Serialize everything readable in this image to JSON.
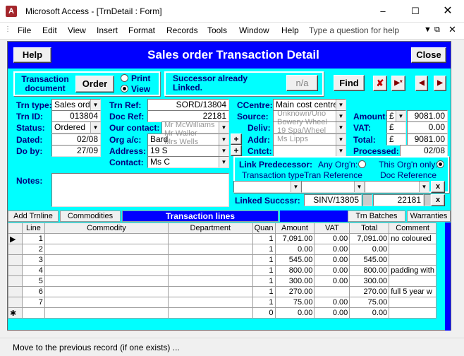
{
  "window": {
    "title": "Microsoft Access - [TrnDetail : Form]",
    "app_icon": "A"
  },
  "menu": [
    "File",
    "Edit",
    "View",
    "Insert",
    "Format",
    "Records",
    "Tools",
    "Window",
    "Help"
  ],
  "help_box": {
    "placeholder": "Type a question for help"
  },
  "header": {
    "help": "Help",
    "title": "Sales order Transaction Detail",
    "close": "Close"
  },
  "trans_doc": {
    "label_line1": "Transaction",
    "label_line2": "document",
    "order_btn": "Order",
    "print": "Print",
    "view": "View",
    "selected": "View"
  },
  "successor": {
    "line1": "Successor already",
    "line2": "Linked.",
    "btn": "n/a"
  },
  "toolbar": {
    "find": "Find"
  },
  "left": {
    "trn_type_label": "Trn type:",
    "trn_type": "Sales orde",
    "trn_id_label": "Trn ID:",
    "trn_id": "013804",
    "status_label": "Status:",
    "status": "Ordered",
    "dated_label": "Dated:",
    "dated": "02/08",
    "doby_label": "Do by:",
    "doby": "27/09"
  },
  "mid": {
    "trn_ref_label": "Trn Ref:",
    "trn_ref": "SORD/13804",
    "doc_ref_label": "Doc Ref:",
    "doc_ref": "22181",
    "our_contact_label": "Our contact:",
    "org_ac_label": "Org a/c:",
    "org_ac": "Bard",
    "address_label": "Address:",
    "address": "19 S",
    "contact_label": "Contact:",
    "contact": "Ms C"
  },
  "right": {
    "ccentre_label": "CCentre:",
    "ccentre": "Main cost centre",
    "source_label": "Source:",
    "deliv_label": "Deliv:",
    "addr_label": "Addr:",
    "cntct_label": "Cntct:",
    "amount_label": "Amount:",
    "amount_cur": "£",
    "amount": "9081.00",
    "vat_label": "VAT:",
    "vat_cur": "£",
    "vat": "0.00",
    "total_label": "Total:",
    "total_cur": "£",
    "total": "9081.00",
    "processed_label": "Processed:",
    "processed": "02/08"
  },
  "link": {
    "title": "Link Predecessor:",
    "any_org": "Any Org'n:",
    "this_org": "This Org'n only:",
    "col1": "Transaction type",
    "col2": "Tran Reference",
    "col3": "Doc Reference",
    "linked_label": "Linked Succssr:",
    "linked_ref": "SINV/13805",
    "linked_doc": "22181",
    "x": "x"
  },
  "notes_label": "Notes:",
  "tabs": [
    "Add Trnline",
    "Commodities",
    "Transaction lines",
    "Trn Batches",
    "Warranties"
  ],
  "grid": {
    "columns": [
      "Line",
      "Commodity",
      "Department",
      "Quan",
      "Amount",
      "VAT",
      "Total",
      "Comment"
    ],
    "rows": [
      [
        "1",
        "",
        "",
        "1",
        "7,091.00",
        "0.00",
        "7,091.00",
        "no coloured"
      ],
      [
        "2",
        "",
        "",
        "1",
        "0.00",
        "0.00",
        "0.00",
        ""
      ],
      [
        "3",
        "",
        "",
        "1",
        "545.00",
        "0.00",
        "545.00",
        ""
      ],
      [
        "4",
        "",
        "",
        "1",
        "800.00",
        "0.00",
        "800.00",
        "padding with"
      ],
      [
        "5",
        "",
        "",
        "1",
        "300.00",
        "0.00",
        "300.00",
        ""
      ],
      [
        "6",
        "",
        "",
        "1",
        "270.00",
        "",
        "270.00",
        "full 5 year w"
      ],
      [
        "7",
        "",
        "",
        "1",
        "75.00",
        "0.00",
        "75.00",
        ""
      ],
      [
        "",
        "",
        "",
        "0",
        "0.00",
        "0.00",
        "0.00",
        ""
      ]
    ]
  },
  "status": "Move to the previous record (if one exists) ..."
}
